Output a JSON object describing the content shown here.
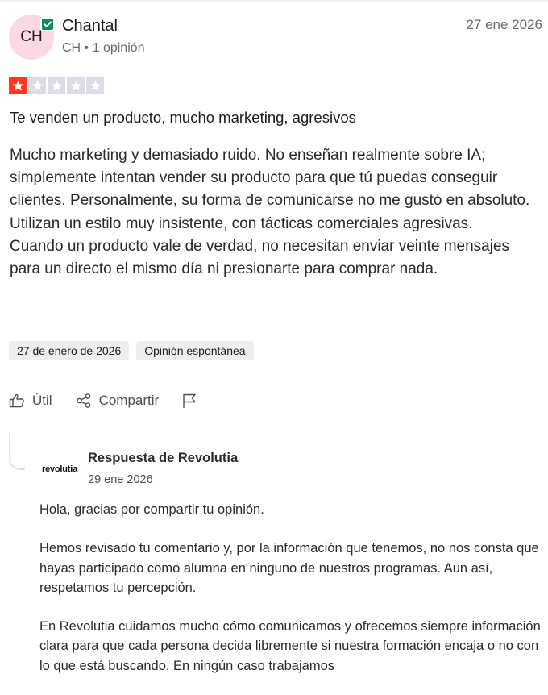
{
  "reviewer": {
    "initials": "CH",
    "name": "Chantal",
    "meta": "CH • 1 opinión",
    "verified_icon": "check-badge-icon"
  },
  "review": {
    "date": "27 ene 2026",
    "rating": 1,
    "rating_max": 5,
    "title": "Te venden un producto, mucho marketing, agresivos",
    "body_paragraphs": [
      "Mucho marketing y demasiado ruido. No enseñan realmente sobre IA; simplemente intentan vender su producto para que tú puedas conseguir clientes. Personalmente, su forma de comunicarse no me gustó en absoluto. Utilizan un estilo muy insistente, con tácticas comerciales agresivas.",
      "Cuando un producto vale de verdad, no necesitan enviar veinte mensajes para un directo el mismo día ni presionarte para comprar nada."
    ],
    "tags": [
      "27 de enero de 2026",
      "Opinión espontánea"
    ]
  },
  "actions": {
    "useful_label": "Útil",
    "share_label": "Compartir",
    "useful_icon": "thumbs-up-icon",
    "share_icon": "share-icon",
    "flag_icon": "flag-icon"
  },
  "reply": {
    "brand_logo_text": "revolutia",
    "title": "Respuesta de Revolutia",
    "date": "29 ene 2026",
    "paragraphs": [
      "Hola, gracias por compartir tu opinión.",
      "Hemos revisado tu comentario y, por la información que tenemos, no nos consta que hayas participado como alumna en ninguno de nuestros programas. Aun así, respetamos tu percepción.",
      "En Revolutia cuidamos mucho cómo comunicamos y ofrecemos siempre información clara para que cada persona decida libremente si nuestra formación encaja o no con lo que está buscando. En ningún caso trabajamos"
    ]
  },
  "colors": {
    "star_filled": "#ff3722",
    "star_empty": "#dcdce6",
    "avatar_bg": "#fbd8e2",
    "verified": "#0d8a57"
  }
}
